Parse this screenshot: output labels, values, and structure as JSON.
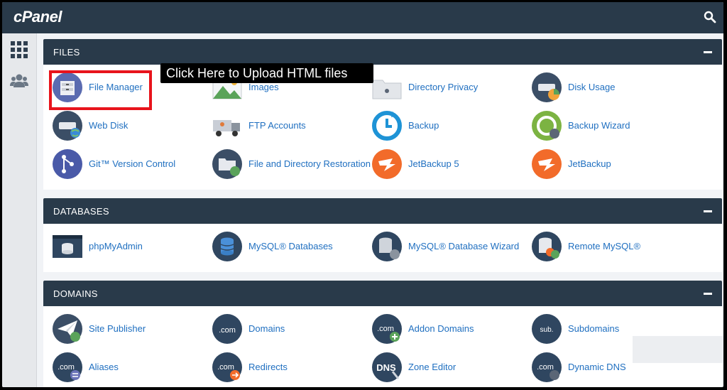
{
  "app": {
    "logo": "cPanel"
  },
  "sidebar": {
    "items": [
      "grid-icon",
      "users-icon"
    ]
  },
  "tooltip": {
    "text": "Click Here to Upload HTML files"
  },
  "sections": {
    "files": {
      "title": "FILES",
      "items": [
        {
          "label": "File Manager"
        },
        {
          "label": "Images"
        },
        {
          "label": "Directory Privacy"
        },
        {
          "label": "Disk Usage"
        },
        {
          "label": "Web Disk"
        },
        {
          "label": "FTP Accounts"
        },
        {
          "label": "Backup"
        },
        {
          "label": "Backup Wizard"
        },
        {
          "label": "Git™ Version Control"
        },
        {
          "label": "File and Directory Restoration"
        },
        {
          "label": "JetBackup 5"
        },
        {
          "label": "JetBackup"
        }
      ]
    },
    "databases": {
      "title": "DATABASES",
      "items": [
        {
          "label": "phpMyAdmin"
        },
        {
          "label": "MySQL® Databases"
        },
        {
          "label": "MySQL® Database Wizard"
        },
        {
          "label": "Remote MySQL®"
        }
      ]
    },
    "domains": {
      "title": "DOMAINS",
      "items": [
        {
          "label": "Site Publisher"
        },
        {
          "label": "Domains"
        },
        {
          "label": "Addon Domains"
        },
        {
          "label": "Subdomains"
        },
        {
          "label": "Aliases"
        },
        {
          "label": "Redirects"
        },
        {
          "label": "Zone Editor"
        },
        {
          "label": "Dynamic DNS"
        }
      ]
    }
  },
  "icon_text": {
    "com": ".com",
    "sub": "sub.",
    "dns": "DNS"
  },
  "colors": {
    "header": "#293a4a",
    "link": "#1f6fc0",
    "highlight": "#e8141c"
  }
}
